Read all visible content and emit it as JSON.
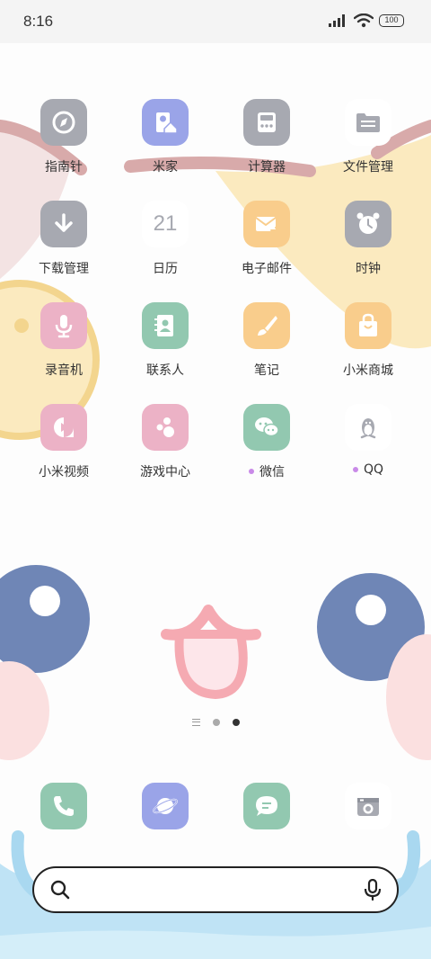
{
  "status_bar": {
    "time": "8:16",
    "battery": "100"
  },
  "apps": [
    {
      "label": "指南针",
      "icon": "compass-icon",
      "color": "#a7a9b1",
      "dot": false
    },
    {
      "label": "米家",
      "icon": "mijia-icon",
      "color": "#9aa4e8",
      "dot": false
    },
    {
      "label": "计算器",
      "icon": "calculator-icon",
      "color": "#a7a9b1",
      "dot": false
    },
    {
      "label": "文件管理",
      "icon": "folder-icon",
      "color": "#ffffff",
      "dot": false
    },
    {
      "label": "下载管理",
      "icon": "download-icon",
      "color": "#a7a9b1",
      "dot": false
    },
    {
      "label": "日历",
      "icon": "calendar-icon",
      "color": "#ffffff",
      "dot": false,
      "glyph": "21"
    },
    {
      "label": "电子邮件",
      "icon": "email-icon",
      "color": "#f9cd8c",
      "dot": false
    },
    {
      "label": "时钟",
      "icon": "clock-icon",
      "color": "#a7a9b1",
      "dot": false
    },
    {
      "label": "录音机",
      "icon": "microphone-icon",
      "color": "#ecb2c6",
      "dot": false
    },
    {
      "label": "联系人",
      "icon": "contacts-icon",
      "color": "#92c8b0",
      "dot": false
    },
    {
      "label": "笔记",
      "icon": "brush-icon",
      "color": "#f9cd8c",
      "dot": false
    },
    {
      "label": "小米商城",
      "icon": "shopping-bag-icon",
      "color": "#f9cd8c",
      "dot": false
    },
    {
      "label": "小米视频",
      "icon": "video-play-icon",
      "color": "#ecb2c6",
      "dot": false
    },
    {
      "label": "游戏中心",
      "icon": "game-center-icon",
      "color": "#ecb2c6",
      "dot": false
    },
    {
      "label": "微信",
      "icon": "wechat-icon",
      "color": "#92c8b0",
      "dot": true
    },
    {
      "label": "QQ",
      "icon": "qq-penguin-icon",
      "color": "#ffffff",
      "dot": true
    }
  ],
  "dock": [
    {
      "icon": "phone-icon",
      "color": "#92c8b0"
    },
    {
      "icon": "browser-planet-icon",
      "color": "#9aa4e8"
    },
    {
      "icon": "messages-icon",
      "color": "#92c8b0"
    },
    {
      "icon": "camera-icon",
      "color": "#ffffff"
    }
  ],
  "page_indicator": {
    "pages": 2,
    "active": 2
  },
  "search": {
    "value": "",
    "placeholder": ""
  }
}
